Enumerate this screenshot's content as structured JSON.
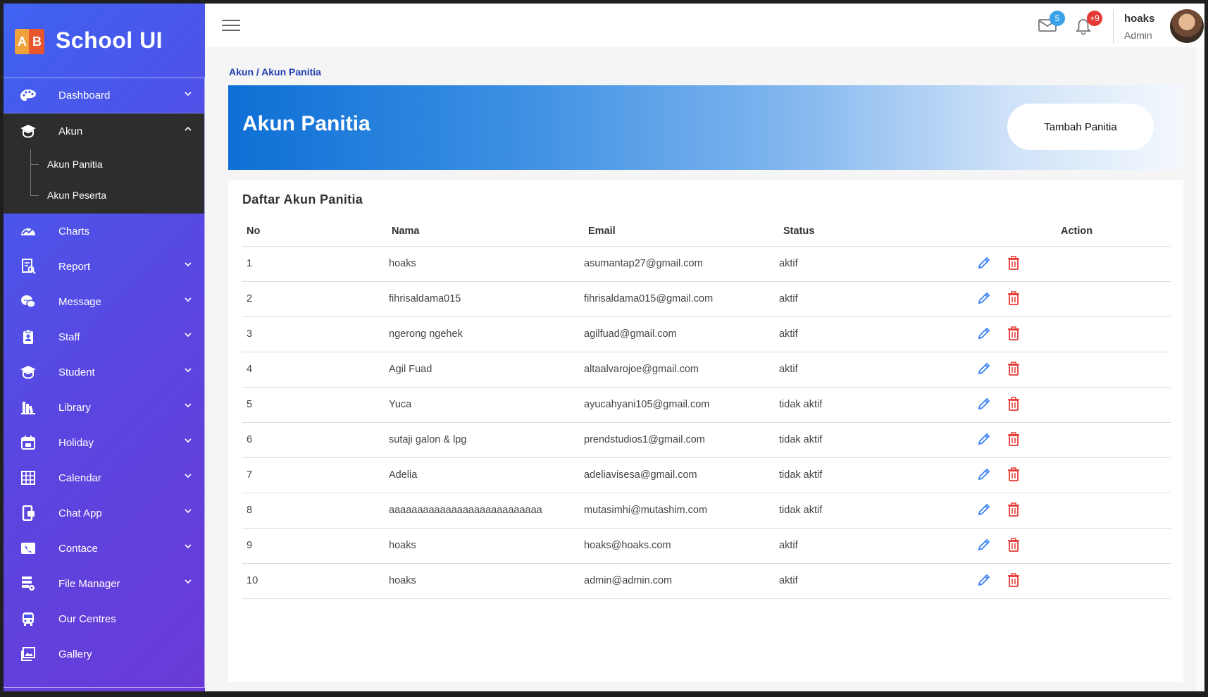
{
  "brand": {
    "title": "School UI",
    "logo_letters": [
      "A",
      "B"
    ]
  },
  "sidebar": {
    "items": [
      {
        "label": "Dashboard",
        "icon": "palette-icon",
        "chevron": "down"
      },
      {
        "label": "Akun",
        "icon": "graduation-cap-icon",
        "chevron": "up",
        "active": true,
        "children": [
          {
            "label": "Akun Panitia"
          },
          {
            "label": "Akun Peserta"
          }
        ]
      },
      {
        "label": "Charts",
        "icon": "chart-icon"
      },
      {
        "label": "Report",
        "icon": "report-icon",
        "chevron": "down"
      },
      {
        "label": "Message",
        "icon": "message-icon",
        "chevron": "down"
      },
      {
        "label": "Staff",
        "icon": "staff-badge-icon",
        "chevron": "down"
      },
      {
        "label": "Student",
        "icon": "graduation-cap-icon",
        "chevron": "down"
      },
      {
        "label": "Library",
        "icon": "library-icon",
        "chevron": "down"
      },
      {
        "label": "Holiday",
        "icon": "calendar-day-icon",
        "chevron": "down"
      },
      {
        "label": "Calendar",
        "icon": "calendar-grid-icon",
        "chevron": "down"
      },
      {
        "label": "Chat App",
        "icon": "chat-app-icon",
        "chevron": "down"
      },
      {
        "label": "Contace",
        "icon": "contact-icon",
        "chevron": "down"
      },
      {
        "label": "File Manager",
        "icon": "file-manager-icon",
        "chevron": "down"
      },
      {
        "label": "Our Centres",
        "icon": "bus-icon"
      },
      {
        "label": "Gallery",
        "icon": "gallery-icon"
      }
    ]
  },
  "topbar": {
    "mail_badge": "5",
    "notification_badge": "+9",
    "user_name": "hoaks",
    "user_role": "Admin",
    "colors": {
      "mail_badge": "#3aa0e8",
      "notification_badge": "#e53935"
    }
  },
  "breadcrumb": {
    "parent": "Akun",
    "separator": " / ",
    "current": "Akun Panitia"
  },
  "hero": {
    "title": "Akun Panitia",
    "button_label": "Tambah Panitia"
  },
  "table": {
    "title": "Daftar Akun Panitia",
    "headers": {
      "no": "No",
      "nama": "Nama",
      "email": "Email",
      "status": "Status",
      "action": "Action"
    },
    "rows": [
      {
        "no": "1",
        "nama": "hoaks",
        "email": "asumantap27@gmail.com",
        "status": "aktif"
      },
      {
        "no": "2",
        "nama": "fihrisaldama015",
        "email": "fihrisaldama015@gmail.com",
        "status": "aktif"
      },
      {
        "no": "3",
        "nama": "ngerong ngehek",
        "email": "agilfuad@gmail.com",
        "status": "aktif"
      },
      {
        "no": "4",
        "nama": "Agil Fuad",
        "email": "altaalvarojoe@gmail.com",
        "status": "aktif"
      },
      {
        "no": "5",
        "nama": "Yuca",
        "email": "ayucahyani105@gmail.com",
        "status": "tidak aktif"
      },
      {
        "no": "6",
        "nama": "sutaji galon & lpg",
        "email": "prendstudios1@gmail.com",
        "status": "tidak aktif"
      },
      {
        "no": "7",
        "nama": "Adelia",
        "email": "adeliavisesa@gmail.com",
        "status": "tidak aktif"
      },
      {
        "no": "8",
        "nama": "aaaaaaaaaaaaaaaaaaaaaaaaaaa",
        "email": "mutasimhi@mutashim.com",
        "status": "tidak aktif"
      },
      {
        "no": "9",
        "nama": "hoaks",
        "email": "hoaks@hoaks.com",
        "status": "aktif"
      },
      {
        "no": "10",
        "nama": "hoaks",
        "email": "admin@admin.com",
        "status": "aktif"
      }
    ],
    "colors": {
      "edit": "#3b82f6",
      "delete": "#e53935"
    }
  }
}
